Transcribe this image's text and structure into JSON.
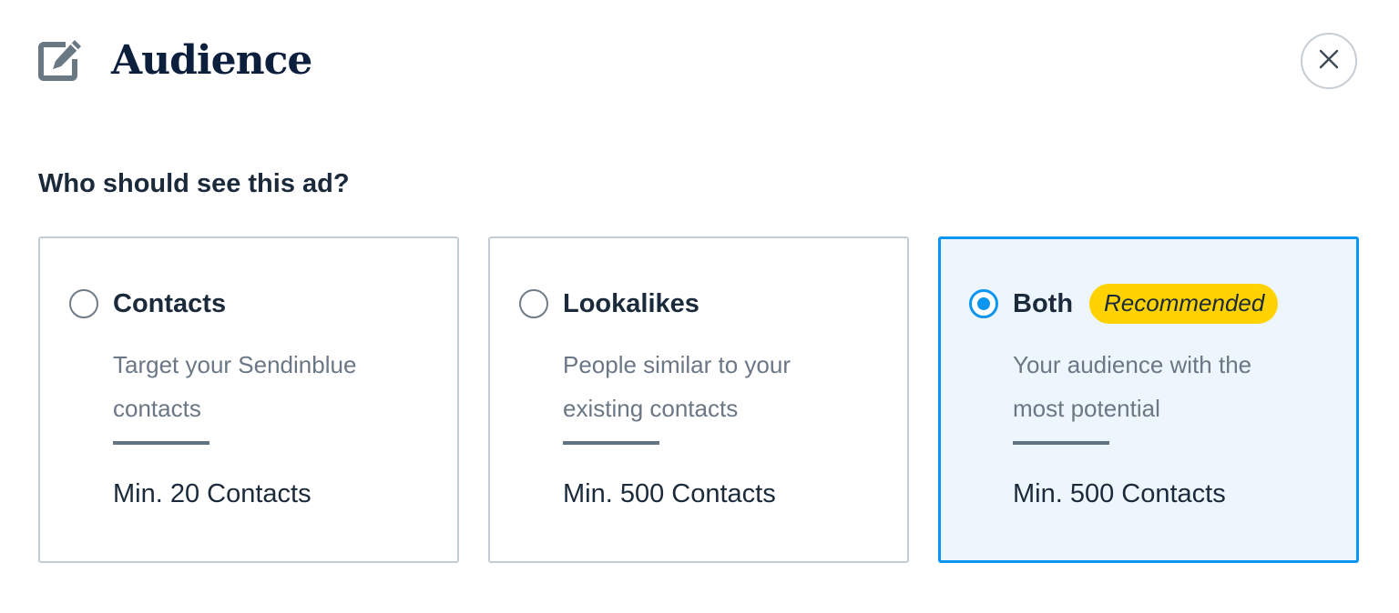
{
  "header": {
    "icon": "edit-icon",
    "title": "Audience",
    "close_icon": "close-icon"
  },
  "question": "Who should see this ad?",
  "options": [
    {
      "title": "Contacts",
      "description": "Target your Sendinblue contacts",
      "minimum": "Min. 20 Contacts",
      "selected": false
    },
    {
      "title": "Lookalikes",
      "description": "People similar to your existing contacts",
      "minimum": "Min. 500 Contacts",
      "selected": false
    },
    {
      "title": "Both",
      "badge": "Recommended",
      "description": "Your audience with the most potential",
      "minimum": "Min. 500 Contacts",
      "selected": true
    }
  ],
  "colors": {
    "accent": "#0b96f2",
    "badge": "#ffd200",
    "selected_background": "#eef6fd",
    "heading": "#0c1f3d"
  }
}
